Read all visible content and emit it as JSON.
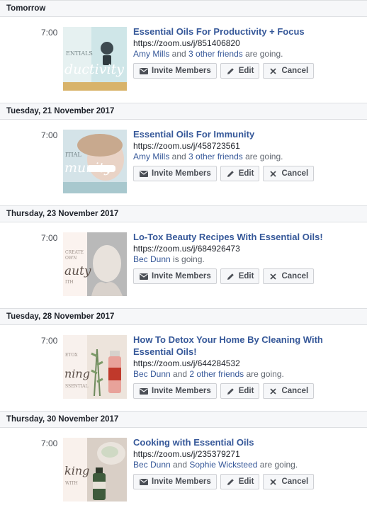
{
  "buttons": {
    "invite": "Invite Members",
    "edit": "Edit",
    "cancel": "Cancel"
  },
  "sections": [
    {
      "date": "Tomorrow",
      "time": "7:00",
      "title": "Essential Oils For Productivity + Focus",
      "link": "https://zoom.us/j/851406820",
      "host": "Amy Mills",
      "connector": " and ",
      "others": "3 other friends",
      "suffix": " are going.",
      "thumb_words": "ductivity"
    },
    {
      "date": "Tuesday, 21 November 2017",
      "time": "7:00",
      "title": "Essential Oils For Immunity",
      "link": "https://zoom.us/j/458723561",
      "host": "Amy Mills",
      "connector": " and ",
      "others": "3 other friends",
      "suffix": " are going.",
      "thumb_words": "munity"
    },
    {
      "date": "Thursday, 23 November 2017",
      "time": "7:00",
      "title": "Lo-Tox Beauty Recipes With Essential Oils!",
      "link": "https://zoom.us/j/684926473",
      "host": "Bec Dunn",
      "connector": "",
      "others": "",
      "suffix": " is going.",
      "thumb_words": "auty"
    },
    {
      "date": "Tuesday, 28 November 2017",
      "time": "7:00",
      "title": "How To Detox Your Home By Cleaning With Essential Oils!",
      "link": "https://zoom.us/j/644284532",
      "host": "Bec Dunn",
      "connector": " and ",
      "others": "2 other friends",
      "suffix": " are going.",
      "thumb_words": "ning"
    },
    {
      "date": "Thursday, 30 November 2017",
      "time": "7:00",
      "title": "Cooking with Essential Oils",
      "link": "https://zoom.us/j/235379271",
      "host": "Bec Dunn",
      "connector": " and ",
      "others": "Sophie Wicksteed",
      "suffix": " are going.",
      "thumb_words": "king"
    }
  ],
  "colors": {
    "link_blue": "#365899",
    "header_bg": "#f6f7f9",
    "border": "#dddfe2"
  }
}
